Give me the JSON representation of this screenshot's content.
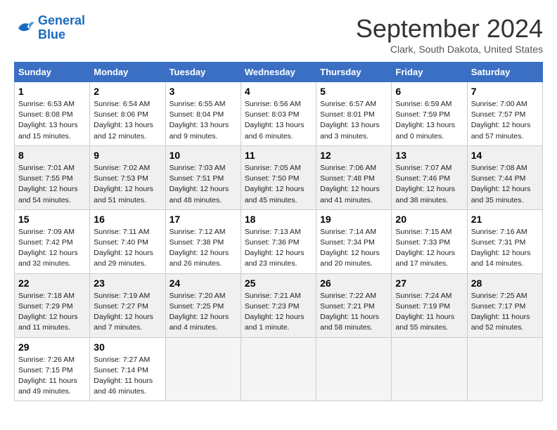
{
  "logo": {
    "line1": "General",
    "line2": "Blue"
  },
  "title": "September 2024",
  "location": "Clark, South Dakota, United States",
  "days_of_week": [
    "Sunday",
    "Monday",
    "Tuesday",
    "Wednesday",
    "Thursday",
    "Friday",
    "Saturday"
  ],
  "weeks": [
    [
      {
        "day": "1",
        "info": "Sunrise: 6:53 AM\nSunset: 8:08 PM\nDaylight: 13 hours\nand 15 minutes."
      },
      {
        "day": "2",
        "info": "Sunrise: 6:54 AM\nSunset: 8:06 PM\nDaylight: 13 hours\nand 12 minutes."
      },
      {
        "day": "3",
        "info": "Sunrise: 6:55 AM\nSunset: 8:04 PM\nDaylight: 13 hours\nand 9 minutes."
      },
      {
        "day": "4",
        "info": "Sunrise: 6:56 AM\nSunset: 8:03 PM\nDaylight: 13 hours\nand 6 minutes."
      },
      {
        "day": "5",
        "info": "Sunrise: 6:57 AM\nSunset: 8:01 PM\nDaylight: 13 hours\nand 3 minutes."
      },
      {
        "day": "6",
        "info": "Sunrise: 6:59 AM\nSunset: 7:59 PM\nDaylight: 13 hours\nand 0 minutes."
      },
      {
        "day": "7",
        "info": "Sunrise: 7:00 AM\nSunset: 7:57 PM\nDaylight: 12 hours\nand 57 minutes."
      }
    ],
    [
      {
        "day": "8",
        "info": "Sunrise: 7:01 AM\nSunset: 7:55 PM\nDaylight: 12 hours\nand 54 minutes."
      },
      {
        "day": "9",
        "info": "Sunrise: 7:02 AM\nSunset: 7:53 PM\nDaylight: 12 hours\nand 51 minutes."
      },
      {
        "day": "10",
        "info": "Sunrise: 7:03 AM\nSunset: 7:51 PM\nDaylight: 12 hours\nand 48 minutes."
      },
      {
        "day": "11",
        "info": "Sunrise: 7:05 AM\nSunset: 7:50 PM\nDaylight: 12 hours\nand 45 minutes."
      },
      {
        "day": "12",
        "info": "Sunrise: 7:06 AM\nSunset: 7:48 PM\nDaylight: 12 hours\nand 41 minutes."
      },
      {
        "day": "13",
        "info": "Sunrise: 7:07 AM\nSunset: 7:46 PM\nDaylight: 12 hours\nand 38 minutes."
      },
      {
        "day": "14",
        "info": "Sunrise: 7:08 AM\nSunset: 7:44 PM\nDaylight: 12 hours\nand 35 minutes."
      }
    ],
    [
      {
        "day": "15",
        "info": "Sunrise: 7:09 AM\nSunset: 7:42 PM\nDaylight: 12 hours\nand 32 minutes."
      },
      {
        "day": "16",
        "info": "Sunrise: 7:11 AM\nSunset: 7:40 PM\nDaylight: 12 hours\nand 29 minutes."
      },
      {
        "day": "17",
        "info": "Sunrise: 7:12 AM\nSunset: 7:38 PM\nDaylight: 12 hours\nand 26 minutes."
      },
      {
        "day": "18",
        "info": "Sunrise: 7:13 AM\nSunset: 7:36 PM\nDaylight: 12 hours\nand 23 minutes."
      },
      {
        "day": "19",
        "info": "Sunrise: 7:14 AM\nSunset: 7:34 PM\nDaylight: 12 hours\nand 20 minutes."
      },
      {
        "day": "20",
        "info": "Sunrise: 7:15 AM\nSunset: 7:33 PM\nDaylight: 12 hours\nand 17 minutes."
      },
      {
        "day": "21",
        "info": "Sunrise: 7:16 AM\nSunset: 7:31 PM\nDaylight: 12 hours\nand 14 minutes."
      }
    ],
    [
      {
        "day": "22",
        "info": "Sunrise: 7:18 AM\nSunset: 7:29 PM\nDaylight: 12 hours\nand 11 minutes."
      },
      {
        "day": "23",
        "info": "Sunrise: 7:19 AM\nSunset: 7:27 PM\nDaylight: 12 hours\nand 7 minutes."
      },
      {
        "day": "24",
        "info": "Sunrise: 7:20 AM\nSunset: 7:25 PM\nDaylight: 12 hours\nand 4 minutes."
      },
      {
        "day": "25",
        "info": "Sunrise: 7:21 AM\nSunset: 7:23 PM\nDaylight: 12 hours\nand 1 minute."
      },
      {
        "day": "26",
        "info": "Sunrise: 7:22 AM\nSunset: 7:21 PM\nDaylight: 11 hours\nand 58 minutes."
      },
      {
        "day": "27",
        "info": "Sunrise: 7:24 AM\nSunset: 7:19 PM\nDaylight: 11 hours\nand 55 minutes."
      },
      {
        "day": "28",
        "info": "Sunrise: 7:25 AM\nSunset: 7:17 PM\nDaylight: 11 hours\nand 52 minutes."
      }
    ],
    [
      {
        "day": "29",
        "info": "Sunrise: 7:26 AM\nSunset: 7:15 PM\nDaylight: 11 hours\nand 49 minutes."
      },
      {
        "day": "30",
        "info": "Sunrise: 7:27 AM\nSunset: 7:14 PM\nDaylight: 11 hours\nand 46 minutes."
      },
      {
        "day": "",
        "info": ""
      },
      {
        "day": "",
        "info": ""
      },
      {
        "day": "",
        "info": ""
      },
      {
        "day": "",
        "info": ""
      },
      {
        "day": "",
        "info": ""
      }
    ]
  ]
}
